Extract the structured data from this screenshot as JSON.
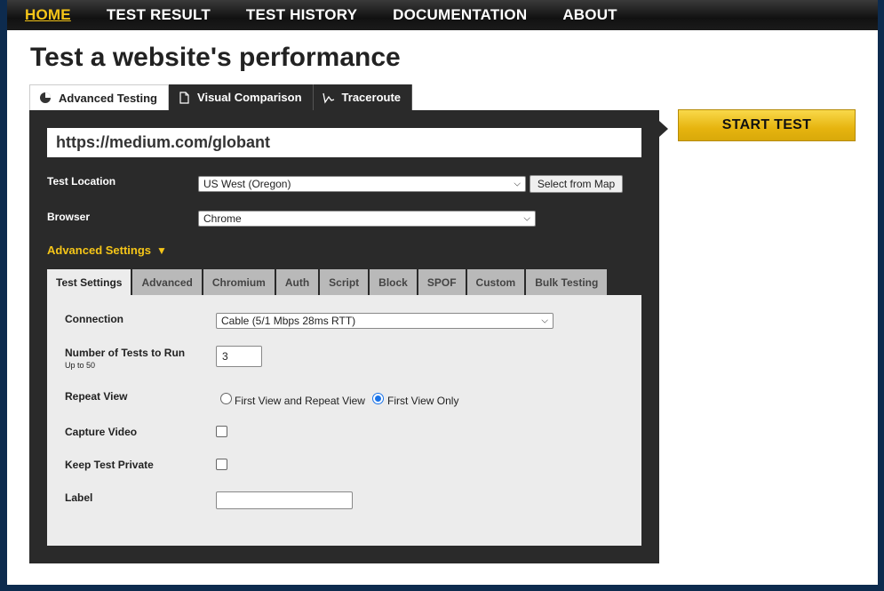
{
  "nav": {
    "items": [
      "HOME",
      "TEST RESULT",
      "TEST HISTORY",
      "DOCUMENTATION",
      "ABOUT"
    ],
    "active": "HOME"
  },
  "page_title": "Test a website's performance",
  "top_tabs": [
    {
      "label": "Advanced Testing",
      "icon": "pie-chart-icon"
    },
    {
      "label": "Visual Comparison",
      "icon": "document-icon"
    },
    {
      "label": "Traceroute",
      "icon": "traceroute-icon"
    }
  ],
  "url_value": "https://medium.com/globant",
  "test_location": {
    "label": "Test Location",
    "value": "US West (Oregon)",
    "map_button": "Select from Map"
  },
  "browser": {
    "label": "Browser",
    "value": "Chrome"
  },
  "advanced_settings": {
    "label": "Advanced Settings",
    "expanded_icon": "▼"
  },
  "sub_tabs": [
    "Test Settings",
    "Advanced",
    "Chromium",
    "Auth",
    "Script",
    "Block",
    "SPOF",
    "Custom",
    "Bulk Testing"
  ],
  "settings": {
    "connection_label": "Connection",
    "connection_value": "Cable (5/1 Mbps 28ms RTT)",
    "num_tests_label": "Number of Tests to Run",
    "num_tests_note": "Up to 50",
    "num_tests_value": "3",
    "repeat_view_label": "Repeat View",
    "repeat_options": [
      "First View and Repeat View",
      "First View Only"
    ],
    "repeat_selected": "First View Only",
    "capture_video_label": "Capture Video",
    "keep_private_label": "Keep Test Private",
    "label_label": "Label",
    "label_value": ""
  },
  "start_button": "START TEST",
  "colors": {
    "accent": "#f5c518",
    "panel": "#2a2a2a",
    "background": "#0d2b4e"
  }
}
